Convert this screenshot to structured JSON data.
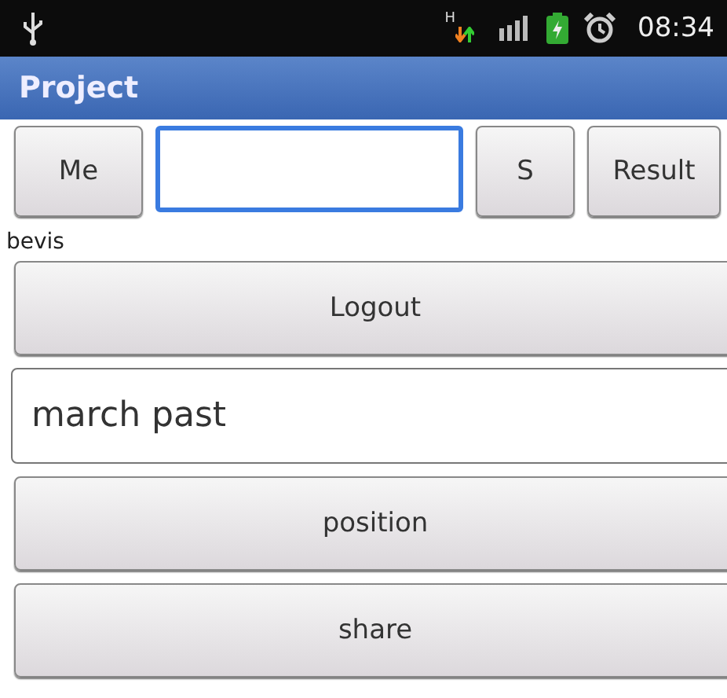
{
  "status_bar": {
    "time": "08:34",
    "network_type": "H"
  },
  "title_bar": {
    "title": "Project"
  },
  "top_row": {
    "me_button": "Me",
    "search": {
      "focused": true
    },
    "s_button": "S",
    "result_button": "Result"
  },
  "user_label": "bevis",
  "items": [
    {
      "kind": "button",
      "text": "Logout"
    },
    {
      "kind": "field",
      "text": "march past"
    },
    {
      "kind": "button",
      "text": "position"
    },
    {
      "kind": "button",
      "text": "share"
    }
  ]
}
